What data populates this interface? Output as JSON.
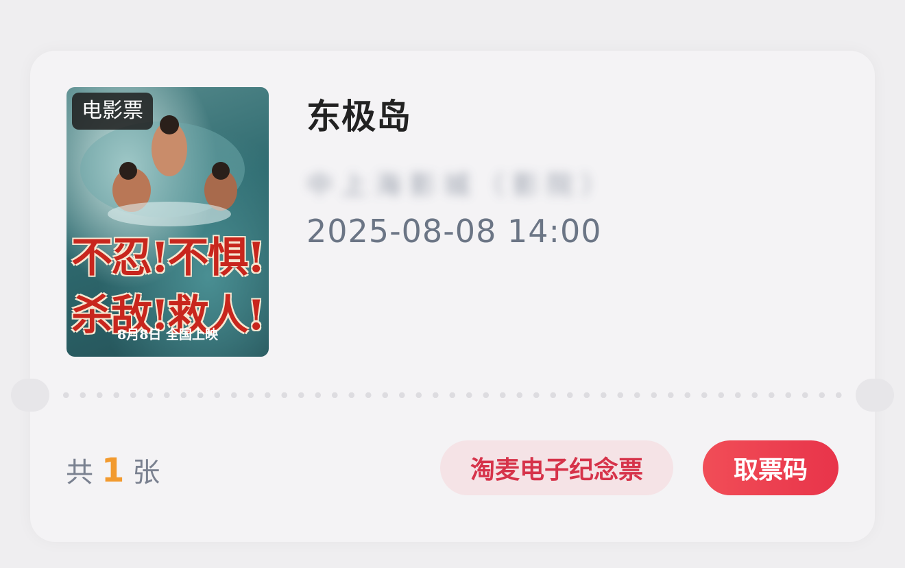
{
  "poster": {
    "badge": "电影票",
    "slogan_line1": "不忍!不惧!",
    "slogan_line2": "杀敌!救人!",
    "release": "8月8日 全国上映"
  },
  "movie": {
    "title": "东极岛",
    "cinema": "中 上 海 影 城 （ 影 院 ）",
    "showtime": "2025-08-08 14:00"
  },
  "footer": {
    "count_prefix": "共",
    "count_value": "1",
    "count_suffix": "张",
    "souvenir_label": "淘麦电子纪念票",
    "ticket_code_label": "取票码"
  },
  "colors": {
    "accent_red": "#e8344a",
    "count_orange": "#f29a2e",
    "souvenir_bg": "#f5e3e6"
  }
}
